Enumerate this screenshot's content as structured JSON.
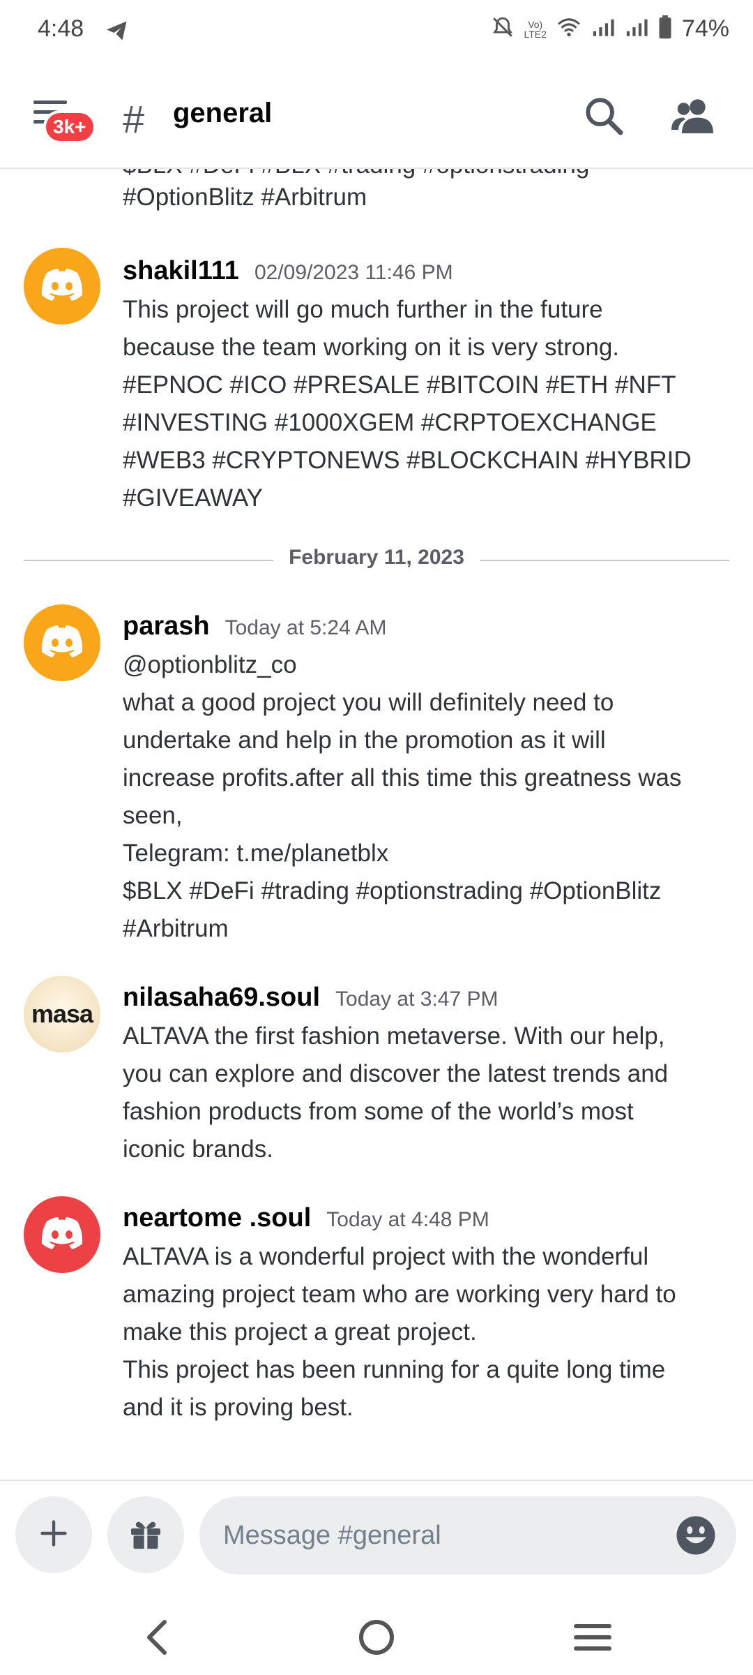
{
  "status_bar": {
    "time": "4:48",
    "battery": "74%",
    "network_label": "LTE2"
  },
  "header": {
    "badge": "3k+",
    "channel_name": "general"
  },
  "previous_message_tail": {
    "cut_line": "$BLX #DeFi #BLX #trading #optionstrading",
    "last_line": "#OptionBlitz #Arbitrum"
  },
  "messages": [
    {
      "username": "shakil111",
      "timestamp": "02/09/2023 11:46 PM",
      "lines": [
        "This project will go much further in the future",
        "because the team working on it is very strong.",
        "#EPNOC #ICO #PRESALE #BITCOIN #ETH #NFT",
        "#INVESTING #1000XGEM #CRPTOEXCHANGE",
        "#WEB3 #CRYPTONEWS #BLOCKCHAIN #HYBRID",
        "#GIVEAWAY"
      ]
    },
    {
      "username": "parash",
      "timestamp": "Today at 5:24 AM",
      "lines": [
        "@optionblitz_co",
        "what a good project you will definitely need to",
        "undertake and help in the promotion as it will",
        "increase profits.after all this time this greatness was",
        "seen,",
        "Telegram: t.me/planetblx",
        "$BLX #DeFi #trading #optionstrading #OptionBlitz",
        "#Arbitrum"
      ]
    },
    {
      "username": "nilasaha69.soul",
      "timestamp": "Today at 3:47 PM",
      "avatar_text": "masa",
      "lines": [
        "ALTAVA the first fashion metaverse. With our help,",
        "you can explore and discover the latest trends and",
        "fashion products from some of the world’s most",
        "iconic brands."
      ]
    },
    {
      "username": "neartome .soul",
      "timestamp": "Today at 4:48 PM",
      "lines": [
        "ALTAVA is a wonderful project with the wonderful",
        "amazing project team who are working very hard to",
        "make this project a great project.",
        "This project has been running for a quite long time",
        "and it is proving best."
      ]
    }
  ],
  "date_divider": "February 11, 2023",
  "composer": {
    "placeholder": "Message #general"
  },
  "colors": {
    "avatar_orange": "#faa61a",
    "avatar_red": "#ed4245",
    "badge_red": "#f23f43"
  }
}
